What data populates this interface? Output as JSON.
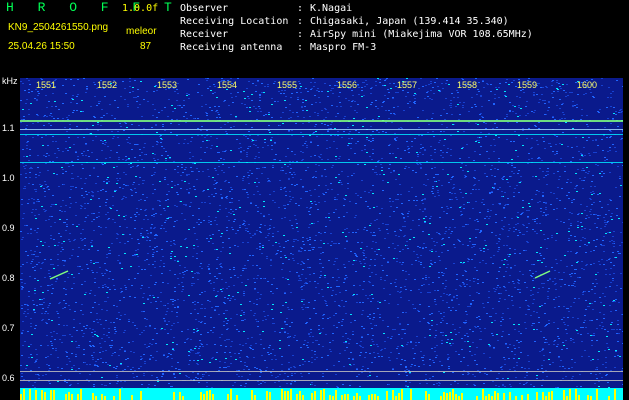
{
  "header": {
    "app_title": "H R O F F T",
    "version": "1.0.0f",
    "filename": "KN9_2504261550.png",
    "detector": "meleor",
    "datetime": "25.04.26 15:50",
    "count": "87"
  },
  "station_info": [
    {
      "key": "Observer",
      "value": "K.Nagai"
    },
    {
      "key": "Receiving Location",
      "value": "Chigasaki, Japan (139.414 35.340)"
    },
    {
      "key": "Receiver",
      "value": "AirSpy mini (Miakejima VOR 108.65MHz)"
    },
    {
      "key": "Receiving antenna",
      "value": "Maspro FM-3"
    }
  ],
  "info_separator": ":",
  "spectrogram": {
    "y_unit": "kHz",
    "y_ticks": [
      "1.1",
      "1.0",
      "0.9",
      "0.8",
      "0.7",
      "0.6"
    ],
    "x_ticks": [
      "1551",
      "1552",
      "1553",
      "1554",
      "1555",
      "1556",
      "1557",
      "1558",
      "1559",
      "1600"
    ],
    "colors": {
      "background": "#0a1a8c",
      "noise_low": "#1e64ff",
      "noise_high": "#00e6ff",
      "carrier": "#7fff7f",
      "bottom_band": "#00ffff",
      "bottom_spikes": "#ffff00"
    }
  }
}
